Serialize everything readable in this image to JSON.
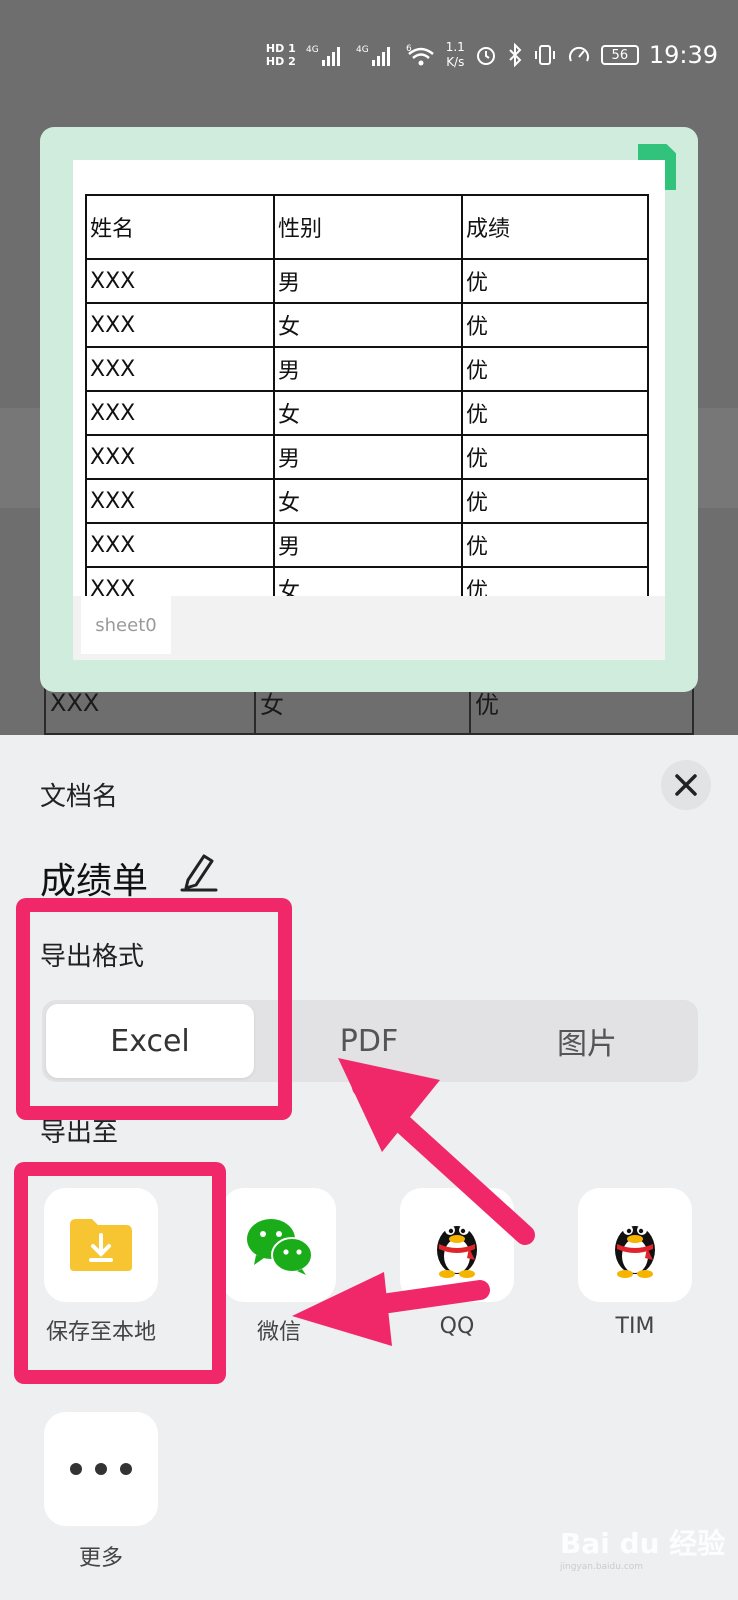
{
  "status_bar": {
    "hd1": "HD 1",
    "hd2": "HD 2",
    "sig1": "4G",
    "sig2": "4G",
    "wifi": "6",
    "speed_value": "1.1",
    "speed_unit": "K/s",
    "battery": "56",
    "time": "19:39"
  },
  "preview": {
    "badge": "X",
    "columns": [
      "姓名",
      "性别",
      "成绩"
    ],
    "rows": [
      [
        "XXX",
        "男",
        "优"
      ],
      [
        "XXX",
        "女",
        "优"
      ],
      [
        "XXX",
        "男",
        "优"
      ],
      [
        "XXX",
        "女",
        "优"
      ],
      [
        "XXX",
        "男",
        "优"
      ],
      [
        "XXX",
        "女",
        "优"
      ],
      [
        "XXX",
        "男",
        "优"
      ],
      [
        "XXX",
        "女",
        "优"
      ]
    ],
    "sheet_tab": "sheet0"
  },
  "background_row": [
    "XXX",
    "女",
    "优"
  ],
  "panel": {
    "doc_label": "文档名",
    "doc_name": "成绩单",
    "format_label": "导出格式",
    "formats": [
      "Excel",
      "PDF",
      "图片"
    ],
    "selected_format": "Excel",
    "export_to_label": "导出至",
    "targets": [
      "保存至本地",
      "微信",
      "QQ",
      "TIM",
      "更多"
    ]
  },
  "watermark": {
    "text": "Bai du 经验",
    "sub": "jingyan.baidu.com"
  },
  "colors": {
    "highlight": "#f0286a",
    "preview_bg": "#cfecdc",
    "excel_green": "#31c27c",
    "wechat_green": "#1aad19",
    "folder_yellow": "#f7c531"
  }
}
